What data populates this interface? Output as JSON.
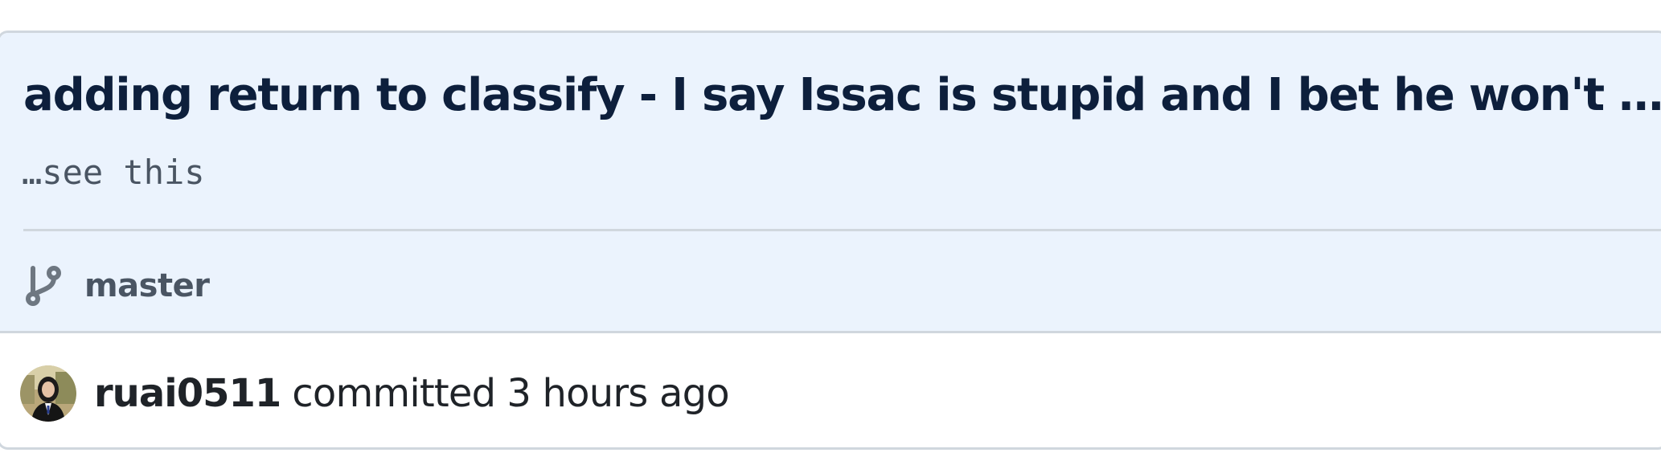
{
  "commit": {
    "title": "adding return to classify - I say Issac is stupid and I bet he won't …",
    "description": "…see this",
    "branch": {
      "name": "master",
      "icon": "git-branch-icon"
    },
    "author": {
      "username": "ruai0511",
      "avatar_icon": "avatar"
    },
    "action": "committed",
    "relative_time": "3 hours ago"
  },
  "colors": {
    "header_bg": "#ebf3fd",
    "border": "#d0d7de",
    "title": "#0d1f3c",
    "muted": "#4a5563",
    "text": "#1f2328"
  }
}
